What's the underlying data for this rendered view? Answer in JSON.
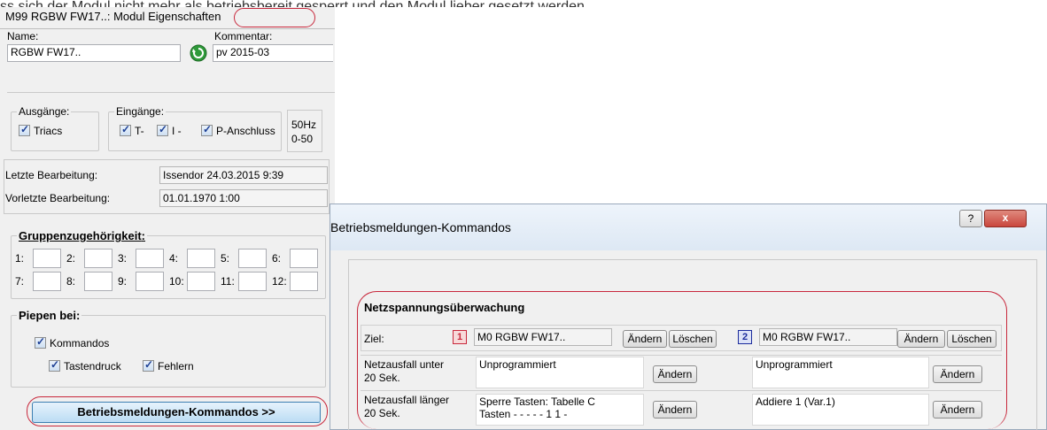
{
  "top_strip_text": "ss sich der Modul nicht mehr als betriebsbereit gesperrt und den Modul lieber gesetzt werden",
  "module_window": {
    "title": "M99 RGBW FW17..: Modul Eigenschaften",
    "name_label": "Name:",
    "name_value": "RGBW FW17..",
    "comment_label": "Kommentar:",
    "comment_value": "pv 2015-03",
    "outputs": {
      "title": "Ausgänge:",
      "triacs": "Triacs"
    },
    "inputs": {
      "title": "Eingänge:",
      "t": "T-",
      "i": "I -",
      "p": "P-Anschluss"
    },
    "freq": {
      "line1": "50Hz",
      "line2": "0-50"
    },
    "last_edit_label": "Letzte Bearbeitung:",
    "last_edit_value": "Issendor 24.03.2015 9:39",
    "prev_edit_label": "Vorletzte Bearbeitung:",
    "prev_edit_value": "01.01.1970 1:00",
    "groups": {
      "title": "Gruppenzugehörigkeit",
      "labels": [
        "1:",
        "2:",
        "3:",
        "4:",
        "5:",
        "6:",
        "7:",
        "8:",
        "9:",
        "10:",
        "11:",
        "12:"
      ]
    },
    "beep": {
      "title": "Piepen bei",
      "commands": "Kommandos",
      "keypress": "Tastendruck",
      "errors": "Fehlern"
    },
    "ops_button": "Betriebsmeldungen-Kommandos >>"
  },
  "dialog": {
    "title": "Betriebsmeldungen-Kommandos",
    "help_btn": "?",
    "close_btn": "x",
    "section_title": "Netzspannungsüberwachung",
    "ziel_label": "Ziel:",
    "target1": {
      "num": "1",
      "value": "M0 RGBW FW17..",
      "change": "Ändern",
      "delete": "Löschen"
    },
    "target2": {
      "num": "2",
      "value": "M0 RGBW FW17..",
      "change": "Ändern",
      "delete": "Löschen"
    },
    "rows": [
      {
        "label_line1": "Netzausfall unter",
        "label_line2": "20 Sek.",
        "cmd1_line1": "Unprogrammiert",
        "cmd1_line2": "",
        "cmd2": "Unprogrammiert",
        "change": "Ändern"
      },
      {
        "label_line1": "Netzausfall länger",
        "label_line2": "20 Sek.",
        "cmd1_line1": "Sperre Tasten: Tabelle C",
        "cmd1_line2": "Tasten - - - -  - 1 1 -",
        "cmd2": "Addiere 1 (Var.1)",
        "change": "Ändern"
      }
    ]
  },
  "colors": {
    "badge1": "#c8283c",
    "badge2": "#1c2c9c",
    "close_red": "#c9463d",
    "annotation": "#c8283c"
  }
}
